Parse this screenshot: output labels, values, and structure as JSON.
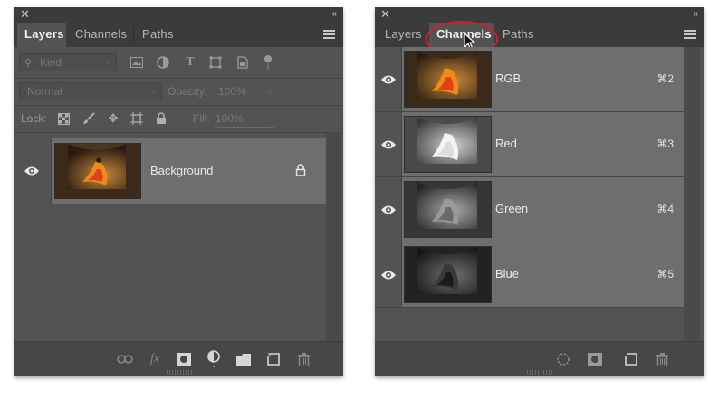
{
  "layers_panel": {
    "tabs": [
      "Layers",
      "Channels",
      "Paths"
    ],
    "active_tab": "Layers",
    "filter": {
      "placeholder": "Kind"
    },
    "blend_mode": "Normal",
    "opacity_label": "Opacity:",
    "opacity_value": "100%",
    "lock_label": "Lock:",
    "fill_label": "Fill:",
    "fill_value": "100%",
    "layers": [
      {
        "name": "Background",
        "visible": true,
        "locked": true
      }
    ],
    "footer_icons": [
      "link-icon",
      "fx-icon",
      "mask-icon",
      "adjustment-icon",
      "folder-icon",
      "new-layer-icon",
      "trash-icon"
    ],
    "fx_label": "fx"
  },
  "channels_panel": {
    "tabs": [
      "Layers",
      "Channels",
      "Paths"
    ],
    "active_tab": "Channels",
    "channels": [
      {
        "name": "RGB",
        "shortcut": "⌘2",
        "visible": true,
        "tone": "color"
      },
      {
        "name": "Red",
        "shortcut": "⌘3",
        "visible": true,
        "tone": "light"
      },
      {
        "name": "Green",
        "shortcut": "⌘4",
        "visible": true,
        "tone": "mid"
      },
      {
        "name": "Blue",
        "shortcut": "⌘5",
        "visible": true,
        "tone": "dark"
      }
    ],
    "footer_icons": [
      "load-selection-icon",
      "save-selection-icon",
      "new-channel-icon",
      "trash-icon"
    ]
  },
  "colors": {
    "panel_bg": "#535353",
    "selected_row": "#6e6e6e",
    "annotation": "#d0202b"
  }
}
